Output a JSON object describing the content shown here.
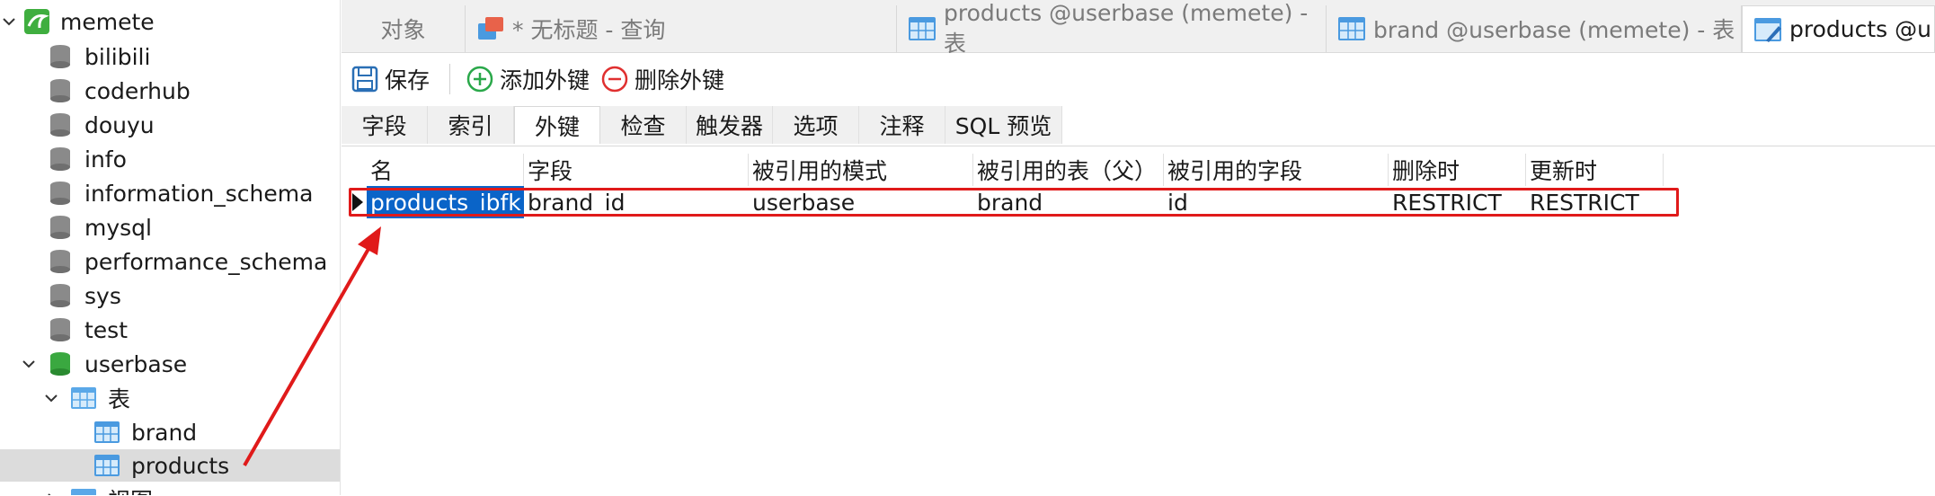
{
  "tree": {
    "connection": "memete",
    "databases": [
      "bilibili",
      "coderhub",
      "douyu",
      "info",
      "information_schema",
      "mysql",
      "performance_schema",
      "sys",
      "test"
    ],
    "open_database": "userbase",
    "tables_folder": "表",
    "tables": [
      "brand",
      "products"
    ],
    "selected_table": "products",
    "partial_next_folder": "视图"
  },
  "tabs": [
    {
      "label": "对象"
    },
    {
      "label": "* 无标题 - 查询"
    },
    {
      "label": "products @userbase (memete) - 表"
    },
    {
      "label": "brand @userbase (memete) - 表"
    },
    {
      "label": "products @u"
    }
  ],
  "toolbar": {
    "save": "保存",
    "add_fk": "添加外键",
    "delete_fk": "删除外键"
  },
  "subtabs": [
    "字段",
    "索引",
    "外键",
    "检查",
    "触发器",
    "选项",
    "注释",
    "SQL 预览"
  ],
  "active_subtab": "外键",
  "grid": {
    "columns": [
      "名",
      "字段",
      "被引用的模式",
      "被引用的表（父）",
      "被引用的字段",
      "删除时",
      "更新时"
    ],
    "rows": [
      [
        "products_ibfk_",
        "brand_id",
        "userbase",
        "brand",
        "id",
        "RESTRICT",
        "RESTRICT"
      ]
    ]
  },
  "colors": {
    "selection": "#0a64c8",
    "annotation": "#e01a1a",
    "add": "#2aa84a",
    "delete": "#e03030"
  }
}
